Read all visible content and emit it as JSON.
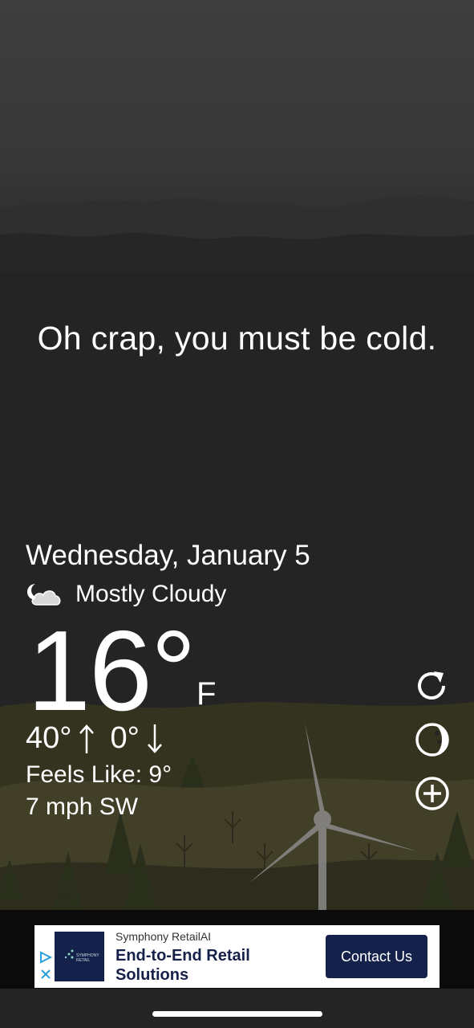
{
  "tagline": "Oh crap, you must be cold.",
  "weather": {
    "date": "Wednesday, January 5",
    "condition": "Mostly Cloudy",
    "condition_icon": "moon-cloud-icon",
    "temperature": "16°",
    "unit": "F",
    "high": "40°",
    "low": "0°",
    "feels_like": "Feels Like: 9°",
    "wind": "7 mph SW"
  },
  "actions": [
    {
      "name": "refresh-icon"
    },
    {
      "name": "moon-phase-icon"
    },
    {
      "name": "add-icon"
    }
  ],
  "ad": {
    "brand": "Symphony RetailAI",
    "title": "End-to-End Retail Solutions",
    "cta": "Contact Us",
    "logo_text": "SYMPHONY RETAIL",
    "colors": {
      "navy": "#14214a"
    }
  }
}
